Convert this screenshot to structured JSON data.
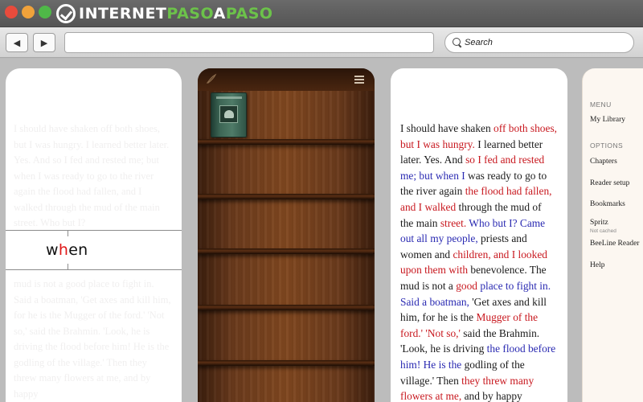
{
  "brand": {
    "logo_part1": "INTERNET",
    "logo_part2": "PASO",
    "logo_part3": "A",
    "logo_part4": "PASO"
  },
  "toolbar": {
    "back_glyph": "◀",
    "forward_glyph": "▶",
    "url_value": "",
    "search_placeholder": "Search"
  },
  "flasher": {
    "word_before": "w",
    "pivot": "h",
    "word_after": "en"
  },
  "faded_text": {
    "top": "I should have shaken off both shoes, but I was hungry. I learned better later. Yes. And so I fed and rested me; but when I was ready to go to the river again the flood had fallen, and I walked through the mud of the main street. Who but I?",
    "bottom": "mud is not a good place to fight in. Said a boatman, 'Get axes and kill him, for he is the Mugger of the ford.' 'Not so,' said the Brahmin. 'Look, he is driving the flood before him! He is the godling of the village.' Then they threw many flowers at me, and by happy"
  },
  "reading": {
    "lines": [
      [
        {
          "t": "I should have shaken ",
          "c": ""
        },
        {
          "t": "off both shoes,",
          "c": "r"
        }
      ],
      [
        {
          "t": "but I was hungry.",
          "c": "r"
        },
        {
          "t": " I learned better",
          "c": ""
        }
      ],
      [
        {
          "t": "later. Yes. And ",
          "c": ""
        },
        {
          "t": "so I fed and rested",
          "c": "r"
        }
      ],
      [
        {
          "t": "me; but when I",
          "c": "b"
        },
        {
          "t": " was ready to go to",
          "c": ""
        }
      ],
      [
        {
          "t": "the river again ",
          "c": ""
        },
        {
          "t": "the flood had fallen,",
          "c": "r"
        }
      ],
      [
        {
          "t": "and I walked",
          "c": "r"
        },
        {
          "t": " through the mud of",
          "c": ""
        }
      ],
      [
        {
          "t": "the main ",
          "c": ""
        },
        {
          "t": "street.",
          "c": "r"
        },
        {
          "t": " Who but I? Came",
          "c": "b"
        }
      ],
      [
        {
          "t": "out all my people,",
          "c": "b"
        },
        {
          "t": " priests and",
          "c": ""
        }
      ],
      [
        {
          "t": "women and ",
          "c": ""
        },
        {
          "t": "children, and I looked",
          "c": "r"
        }
      ],
      [
        {
          "t": "upon them with",
          "c": "r"
        },
        {
          "t": " benevolence. The",
          "c": ""
        }
      ],
      [
        {
          "t": "mud is not a ",
          "c": ""
        },
        {
          "t": "good",
          "c": "r"
        },
        {
          "t": " place to fight in.",
          "c": "b"
        }
      ],
      [
        {
          "t": "Said a boatman,",
          "c": "b"
        },
        {
          "t": " 'Get axes and kill",
          "c": ""
        }
      ],
      [
        {
          "t": "him, for he is the ",
          "c": ""
        },
        {
          "t": "Mugger of the",
          "c": "r"
        }
      ],
      [
        {
          "t": "ford.' 'Not so,'",
          "c": "r"
        },
        {
          "t": " said the Brahmin.",
          "c": ""
        }
      ],
      [
        {
          "t": "'Look, he is driving ",
          "c": ""
        },
        {
          "t": "the flood before",
          "c": "b"
        }
      ],
      [
        {
          "t": "him! He is the",
          "c": "b"
        },
        {
          "t": " godling of the",
          "c": ""
        }
      ],
      [
        {
          "t": "village.' Then ",
          "c": ""
        },
        {
          "t": "they threw many",
          "c": "r"
        }
      ],
      [
        {
          "t": "flowers at me,",
          "c": "r"
        },
        {
          "t": " and by happy",
          "c": ""
        }
      ]
    ]
  },
  "menu": {
    "heading_menu": "MENU",
    "my_library": "My Library",
    "heading_options": "OPTIONS",
    "chapters": "Chapters",
    "reader_setup": "Reader setup",
    "bookmarks": "Bookmarks",
    "spritz": "Spritz",
    "spritz_status": "Not cached",
    "beeline_reader": "BeeLine Reader",
    "help": "Help"
  },
  "colors": {
    "highlight_red": "#c8181f",
    "highlight_blue": "#2a2ab2",
    "pivot_red": "#e01818",
    "brand_green": "#6cc24a"
  }
}
